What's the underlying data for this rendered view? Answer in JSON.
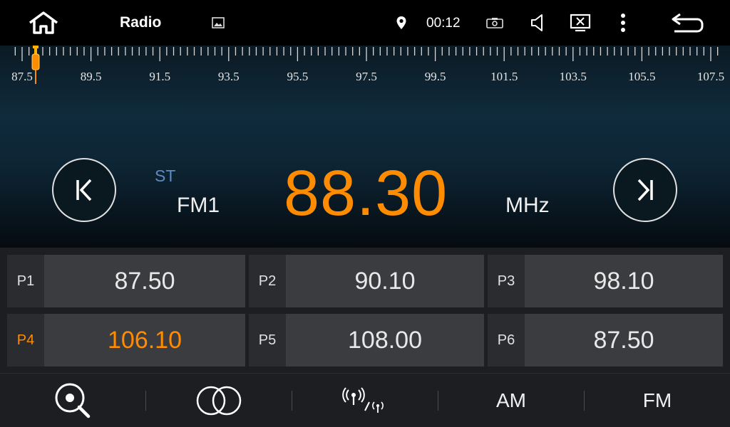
{
  "status_bar": {
    "title": "Radio",
    "time": "00:12",
    "icons": [
      "home-icon",
      "gallery-icon",
      "location-icon",
      "screenshot-icon",
      "volume-icon",
      "screen-off-icon",
      "more-icon",
      "back-icon"
    ]
  },
  "scale": {
    "labels": [
      "87.5",
      "89.5",
      "91.5",
      "93.5",
      "95.5",
      "97.5",
      "99.5",
      "101.5",
      "103.5",
      "105.5",
      "107.5"
    ],
    "range": [
      87.5,
      107.5
    ],
    "marker_value": 87.9
  },
  "tuner": {
    "stereo": "ST",
    "band": "FM1",
    "frequency": "88.30",
    "unit": "MHz"
  },
  "presets": [
    {
      "label": "P1",
      "value": "87.50",
      "active": false
    },
    {
      "label": "P2",
      "value": "90.10",
      "active": false
    },
    {
      "label": "P3",
      "value": "98.10",
      "active": false
    },
    {
      "label": "P4",
      "value": "106.10",
      "active": true
    },
    {
      "label": "P5",
      "value": "108.00",
      "active": false
    },
    {
      "label": "P6",
      "value": "87.50",
      "active": false
    }
  ],
  "bottom_bar": {
    "search_icon": "search-icon",
    "stereo_icon": "stereo-mono-icon",
    "local_distant_icon": "local-distant-icon",
    "am_label": "AM",
    "fm_label": "FM"
  },
  "colors": {
    "accent": "#ff8c00",
    "stereo": "#5f8bc2",
    "preset_bg": "#3b3c40",
    "preset_num_bg": "#2b2c30"
  }
}
